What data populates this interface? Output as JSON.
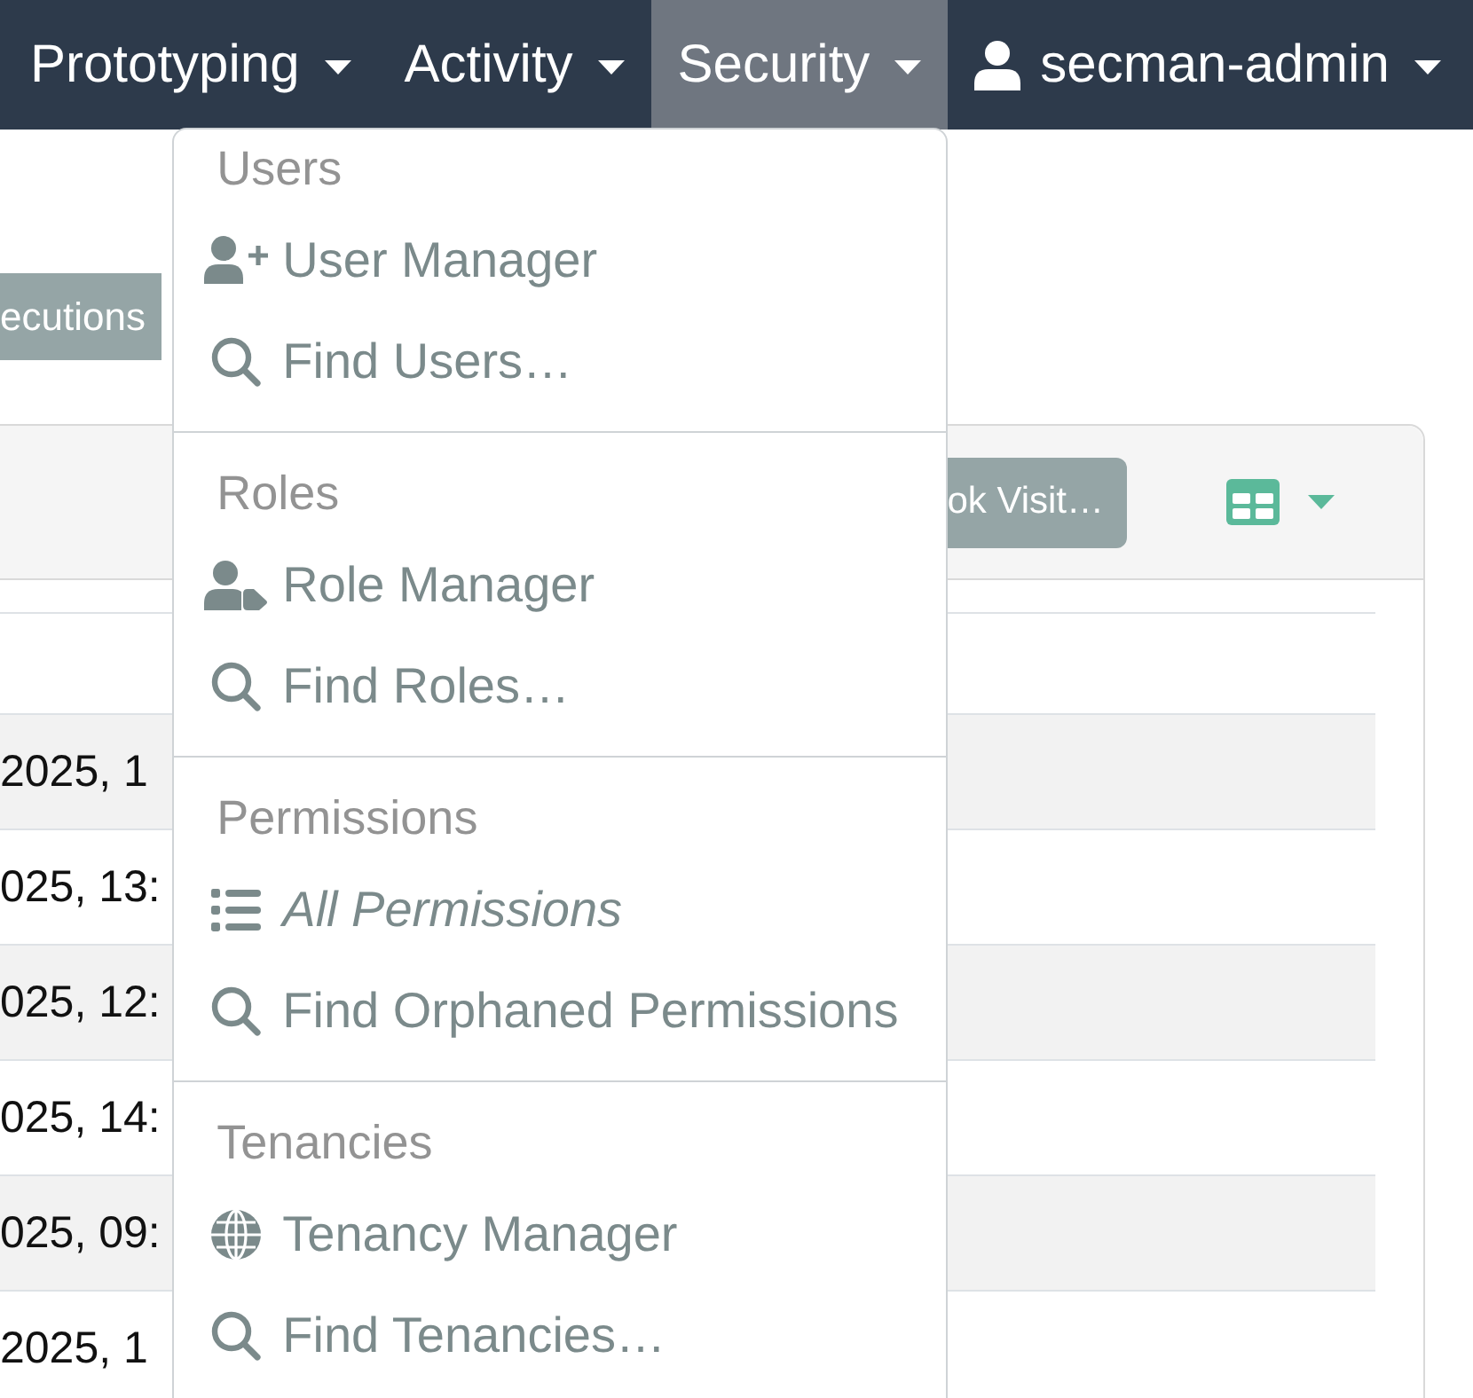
{
  "navbar": {
    "items": [
      {
        "label": "Prototyping",
        "kind": "menu",
        "selected": false
      },
      {
        "label": "Activity",
        "kind": "menu",
        "selected": false
      },
      {
        "label": "Security",
        "kind": "menu",
        "selected": true
      },
      {
        "label": "secman-admin",
        "kind": "user",
        "selected": false
      }
    ]
  },
  "dropdown_menu": {
    "sections": [
      {
        "title": "Users",
        "items": [
          {
            "label": "User Manager",
            "kind": "user",
            "prototype": false
          },
          {
            "label": "Find Users…",
            "kind": "search",
            "prototype": false
          }
        ]
      },
      {
        "title": "Roles",
        "items": [
          {
            "label": "Role Manager",
            "kind": "role",
            "prototype": false
          },
          {
            "label": "Find Roles…",
            "kind": "search",
            "prototype": false
          }
        ]
      },
      {
        "title": "Permissions",
        "items": [
          {
            "label": "All Permissions",
            "kind": "list",
            "prototype": true
          },
          {
            "label": "Find Orphaned Permissions",
            "kind": "search",
            "prototype": false
          }
        ]
      },
      {
        "title": "Tenancies",
        "items": [
          {
            "label": "Tenancy Manager",
            "kind": "globe",
            "prototype": false
          },
          {
            "label": "Find Tenancies…",
            "kind": "search",
            "prototype": false
          }
        ]
      }
    ]
  },
  "toolbar": {
    "buttons": [
      {
        "label": "ecutions"
      }
    ]
  },
  "table_card": {
    "header_buttons": [
      {
        "label": "ok Visit…"
      }
    ],
    "rows": [
      {
        "cells": [
          "2025, 1"
        ]
      },
      {
        "cells": [
          "025, 13:"
        ]
      },
      {
        "cells": [
          "025, 12:"
        ]
      },
      {
        "cells": [
          "025, 14:"
        ]
      },
      {
        "cells": [
          "025, 09:"
        ]
      },
      {
        "cells": [
          "2025, 1"
        ]
      }
    ]
  }
}
